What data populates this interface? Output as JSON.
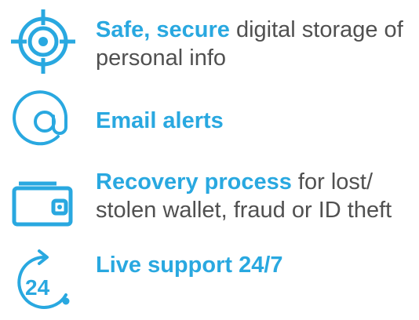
{
  "colors": {
    "accent": "#29a8e0",
    "body_text": "#505050"
  },
  "features": [
    {
      "icon": "target-icon",
      "highlight": "Safe, secure",
      "rest": " digital storage of personal info"
    },
    {
      "icon": "at-sign-icon",
      "highlight": "Email alerts",
      "rest": ""
    },
    {
      "icon": "wallet-icon",
      "highlight": "Recovery process",
      "rest": " for lost/ stolen wallet, fraud or ID theft"
    },
    {
      "icon": "clock-24-icon",
      "highlight": "Live support 24/7",
      "rest": ""
    }
  ]
}
